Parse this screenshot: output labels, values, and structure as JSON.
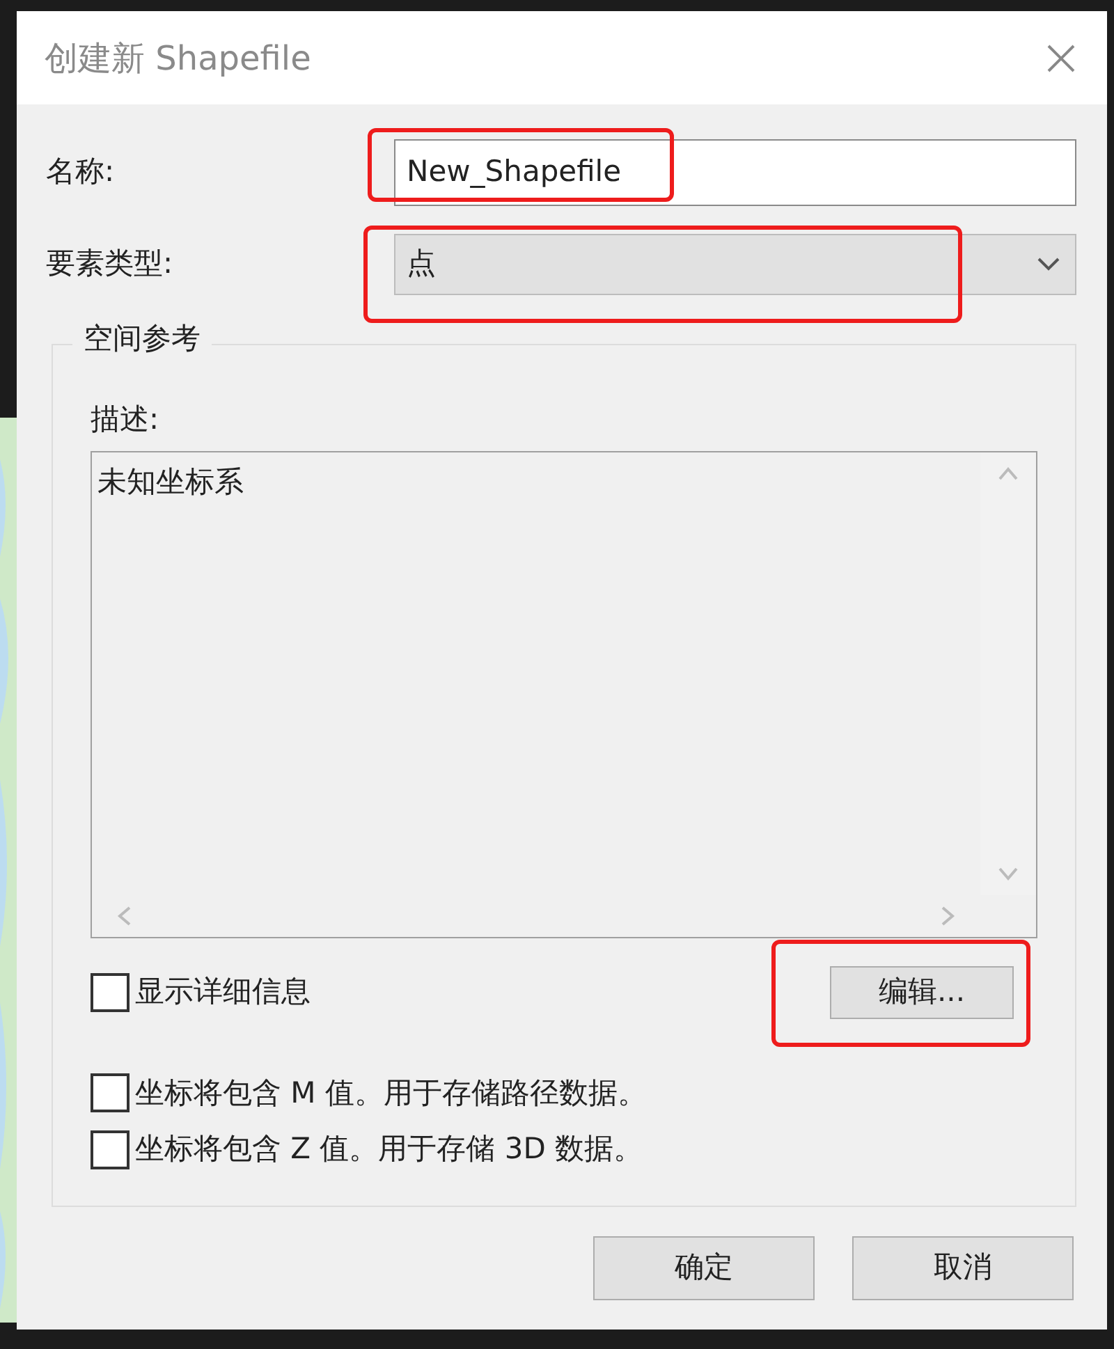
{
  "window": {
    "title": "创建新 Shapefile"
  },
  "name_field": {
    "label": "名称:",
    "value": "New_Shapefile",
    "highlighted": true
  },
  "feature_type": {
    "label": "要素类型:",
    "value": "点",
    "highlighted": true
  },
  "spatial_reference": {
    "legend": "空间参考",
    "description_label": "描述:",
    "description": "未知坐标系",
    "show_details": {
      "label": "显示详细信息",
      "checked": false
    },
    "edit_button": {
      "label": "编辑...",
      "highlighted": true
    }
  },
  "options": [
    {
      "label": "坐标将包含 M 值。用于存储路径数据。",
      "checked": false
    },
    {
      "label": "坐标将包含 Z 值。用于存储 3D 数据。",
      "checked": false
    }
  ],
  "buttons": [
    "确定",
    "取消"
  ]
}
